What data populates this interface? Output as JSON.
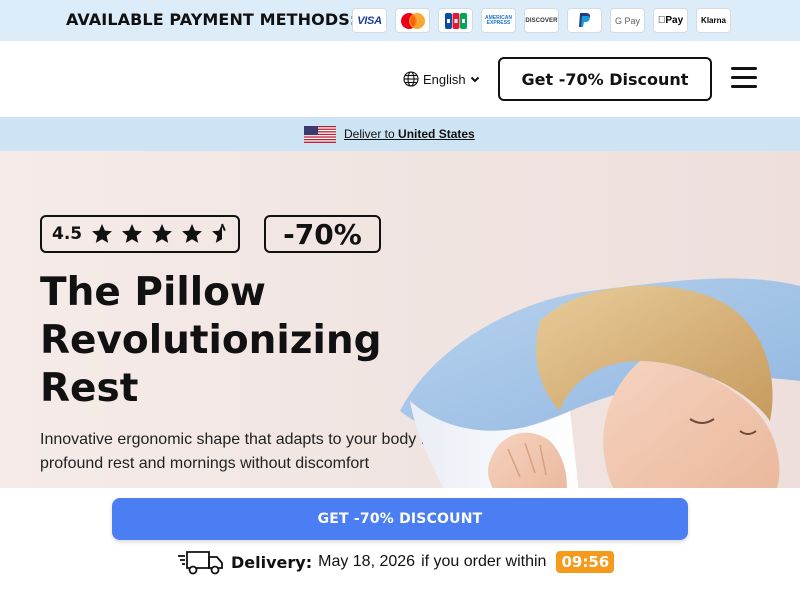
{
  "payment_bar": {
    "title": "AVAILABLE PAYMENT METHODS:",
    "methods": [
      "VISA",
      "Mastercard",
      "JCB",
      "American Express",
      "DISCOVER",
      "PayPal",
      "G Pay",
      "Apple Pay",
      "Klarna"
    ],
    "labels": {
      "visa": "VISA",
      "amex_1": "AMERICAN",
      "amex_2": "EXPRESS",
      "discover": "DISCOVER",
      "gpay": "G Pay",
      "apay": "Pay",
      "klarna": "Klarna"
    }
  },
  "header": {
    "language": "English",
    "cta_label": "Get -70% Discount"
  },
  "deliver_bar": {
    "prefix": "Deliver to",
    "country": "United States"
  },
  "hero": {
    "rating": "4.5",
    "rating_stars": 4.5,
    "discount_badge": "-70%",
    "title_lines": [
      "The Pillow",
      "Revolutionizing",
      "Rest"
    ],
    "subtitle": "Innovative ergonomic shape that adapts to your body for profound rest and mornings without discomfort"
  },
  "sticky": {
    "cta_label": "GET -70% DISCOUNT",
    "delivery_label": "Delivery:",
    "delivery_date": "May 18, 2026",
    "delivery_condition": "if you order within",
    "timer": "09:56"
  },
  "colors": {
    "payment_bar_bg": "#dcecf8",
    "deliver_bar_bg": "#cde4f5",
    "cta_blue": "#4a7ef2",
    "timer_orange": "#f59a1b",
    "hero_bg": "#f2e6e3"
  },
  "icons": [
    "globe-icon",
    "chevron-down-icon",
    "menu-icon",
    "us-flag-icon",
    "star-icon",
    "half-star-icon",
    "delivery-truck-icon"
  ]
}
